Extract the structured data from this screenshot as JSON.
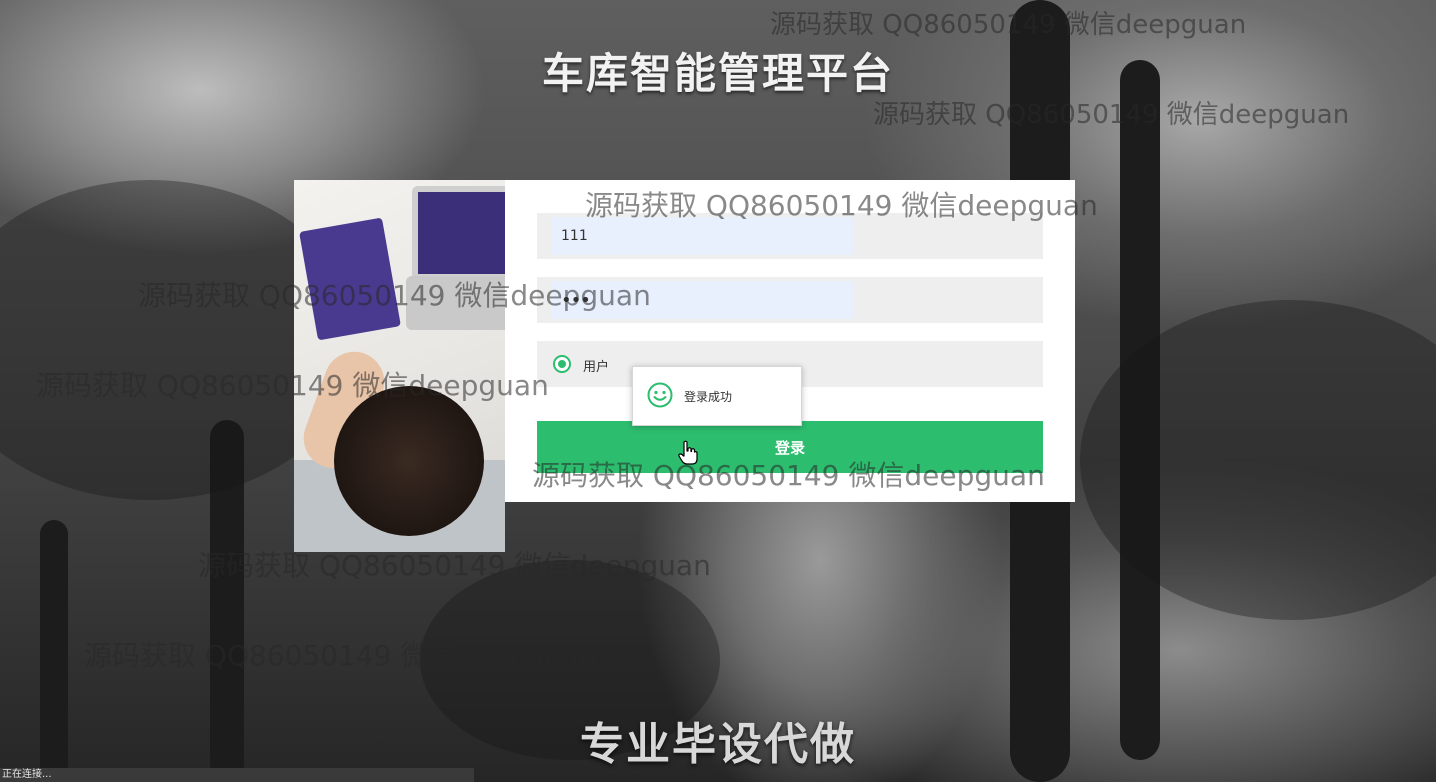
{
  "page": {
    "title": "车库智能管理平台",
    "slogan": "专业毕设代做"
  },
  "login": {
    "username_value": "111",
    "password_value": "•••",
    "role_label": "用户",
    "role_selected": true,
    "submit_label": "登录"
  },
  "toast": {
    "icon": "smile-icon",
    "message": "登录成功"
  },
  "watermarks": [
    "源码获取 QQ86050149 微信deepguan",
    "源码获取 QQ86050149 微信deepguan",
    "源码获取 QQ86050149 微信deepguan",
    "源码获取 QQ86050149 微信deepguan",
    "源码获取 QQ86050149 微信deepguan",
    "源码获取 QQ86050149 微信deepguan",
    "源码获取 QQ86050149 微信deepguan",
    "源码获取 QQ86050149 微信deepguan"
  ],
  "status_bar": {
    "text": "正在连接..."
  },
  "colors": {
    "accent": "#2dbd6e",
    "input_fill": "#e8f0fe",
    "field_bg": "#eeeeee"
  }
}
